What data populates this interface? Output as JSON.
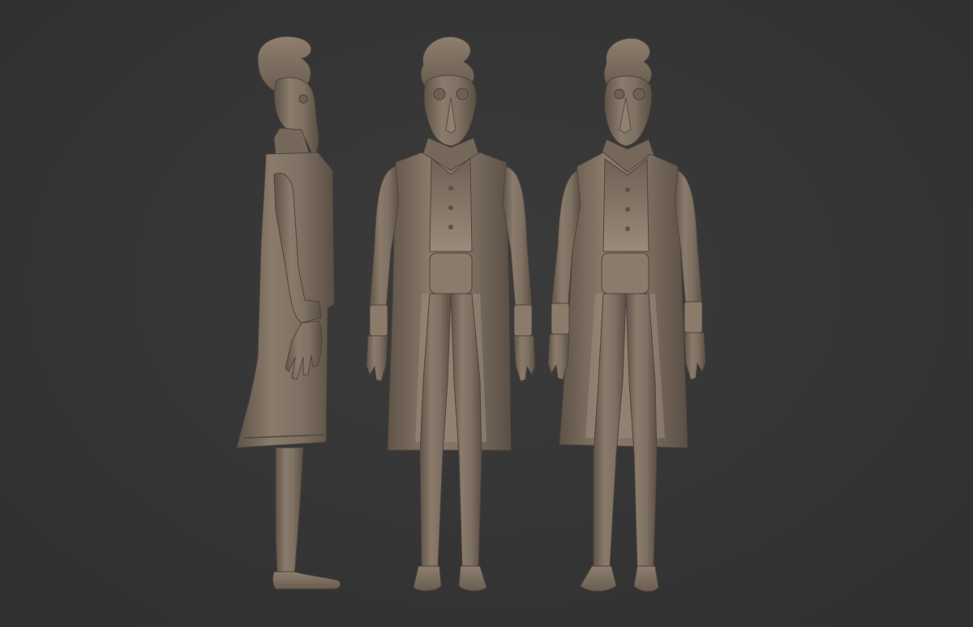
{
  "scene": {
    "background_color": "#353535",
    "clay_color": "#7f7163",
    "clay_shadow": "#5c5045",
    "clay_highlight": "#9c8d7d",
    "views": [
      {
        "name": "side-view",
        "icon": "character-side-figure"
      },
      {
        "name": "front-view",
        "icon": "character-front-figure"
      },
      {
        "name": "three-quarter-view",
        "icon": "character-three-quarter-figure"
      }
    ]
  }
}
